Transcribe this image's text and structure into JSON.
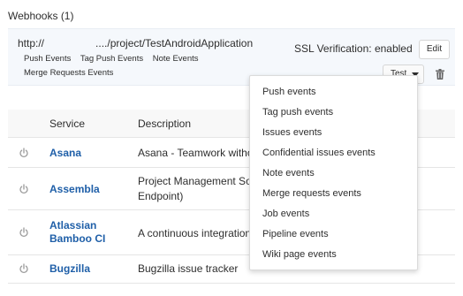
{
  "webhooks": {
    "title": "Webhooks (1)",
    "items": [
      {
        "url_prefix": "http://",
        "url_suffix": "..../project/TestAndroidApplication",
        "events_row1": [
          "Push Events",
          "Tag Push Events",
          "Note Events"
        ],
        "events_row2": [
          "Merge Requests Events"
        ],
        "ssl_status": "SSL Verification: enabled",
        "edit_label": "Edit",
        "test_label": "Test"
      }
    ]
  },
  "test_menu": {
    "items": [
      "Push events",
      "Tag push events",
      "Issues events",
      "Confidential issues events",
      "Note events",
      "Merge requests events",
      "Job events",
      "Pipeline events",
      "Wiki page events"
    ]
  },
  "services_table": {
    "headers": {
      "service": "Service",
      "description": "Description"
    },
    "rows": [
      {
        "name": "Asana",
        "description": "Asana - Teamwork withou"
      },
      {
        "name": "Assembla",
        "description_line1": "Project Management Soft",
        "description_line2": "Endpoint)"
      },
      {
        "name_line1": "Atlassian",
        "name_line2": "Bamboo CI",
        "description": "A continuous integration"
      },
      {
        "name": "Bugzilla",
        "description": "Bugzilla issue tracker"
      }
    ]
  },
  "colors": {
    "link": "#1f5fa8",
    "panel_bg": "#f5f8fc",
    "header_bg": "#f8f8f8",
    "icon_gray": "#9a9a9a"
  },
  "icons": {
    "power": "power-icon",
    "trash": "trash-icon",
    "caret": "caret-down-icon"
  }
}
